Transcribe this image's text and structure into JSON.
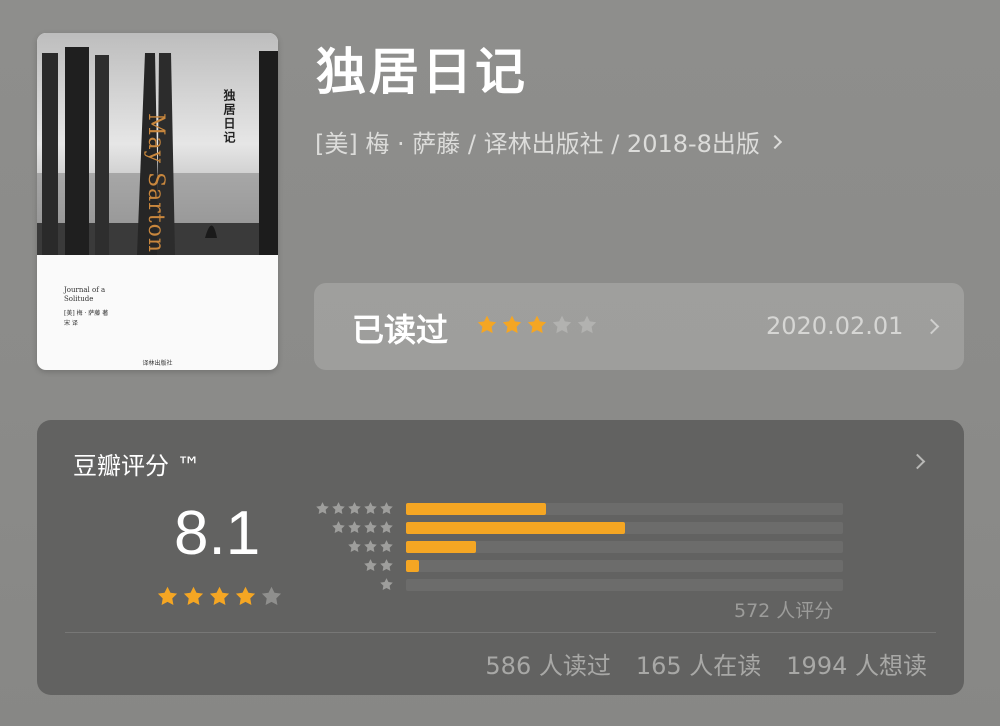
{
  "book": {
    "title": "独居日记",
    "meta": "[美] 梅 · 萨藤 / 译林出版社 / 2018-8出版",
    "cover": {
      "author_en": "May Sarton",
      "title_cn": "独居日记",
      "subtitle_en": "Journal of a Solitude",
      "credits": [
        "[美] 梅 · 萨藤 著",
        "宋 译"
      ],
      "publisher": "译林出版社"
    }
  },
  "read_status": {
    "label": "已读过",
    "my_rating": 3,
    "max_rating": 5,
    "date": "2020.02.01"
  },
  "rating": {
    "heading": "豆瓣评分 ™",
    "score": "8.1",
    "avg_stars": 4,
    "max_stars": 5,
    "distribution": [
      {
        "stars": 5,
        "fraction": 0.32
      },
      {
        "stars": 4,
        "fraction": 0.5
      },
      {
        "stars": 3,
        "fraction": 0.16
      },
      {
        "stars": 2,
        "fraction": 0.03
      },
      {
        "stars": 1,
        "fraction": 0.0
      }
    ],
    "count_text": "572 人评分",
    "stats": [
      "586 人读过",
      "165 人在读",
      "1994 人想读"
    ]
  },
  "colors": {
    "star_active": "#f5a623",
    "star_inactive_light": "#b2b2b0",
    "star_inactive_dark": "#8f8f8d",
    "bar_fill": "#f5a623",
    "bar_track": "#6c6c6b",
    "card_bg": "#626261"
  },
  "icons": [
    "star-icon",
    "chevron-right-icon"
  ]
}
